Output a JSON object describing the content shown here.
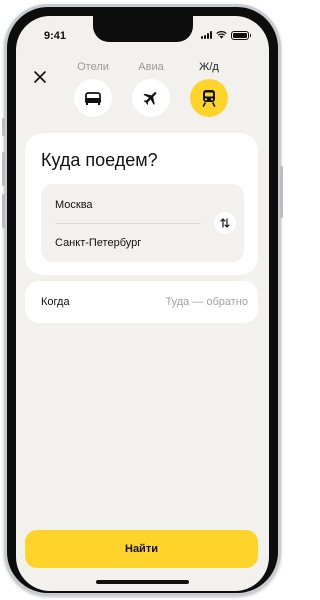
{
  "status_bar": {
    "time": "9:41"
  },
  "header": {
    "close_icon": "close-icon",
    "tabs": [
      {
        "label": "Отели",
        "icon": "bed-icon",
        "active": false
      },
      {
        "label": "Авиа",
        "icon": "plane-icon",
        "active": false
      },
      {
        "label": "Ж/д",
        "icon": "train-icon",
        "active": true
      }
    ]
  },
  "search_card": {
    "title": "Куда поедем?",
    "from": "Москва",
    "to": "Санкт-Петербург",
    "swap_icon": "swap-arrows-icon"
  },
  "when": {
    "label": "Когда",
    "placeholder": "Туда — обратно"
  },
  "find_button": {
    "label": "Найти"
  },
  "colors": {
    "accent": "#fed42b",
    "background": "#f2f1ed",
    "card": "#ffffff",
    "muted_text": "#9a9a9a"
  }
}
